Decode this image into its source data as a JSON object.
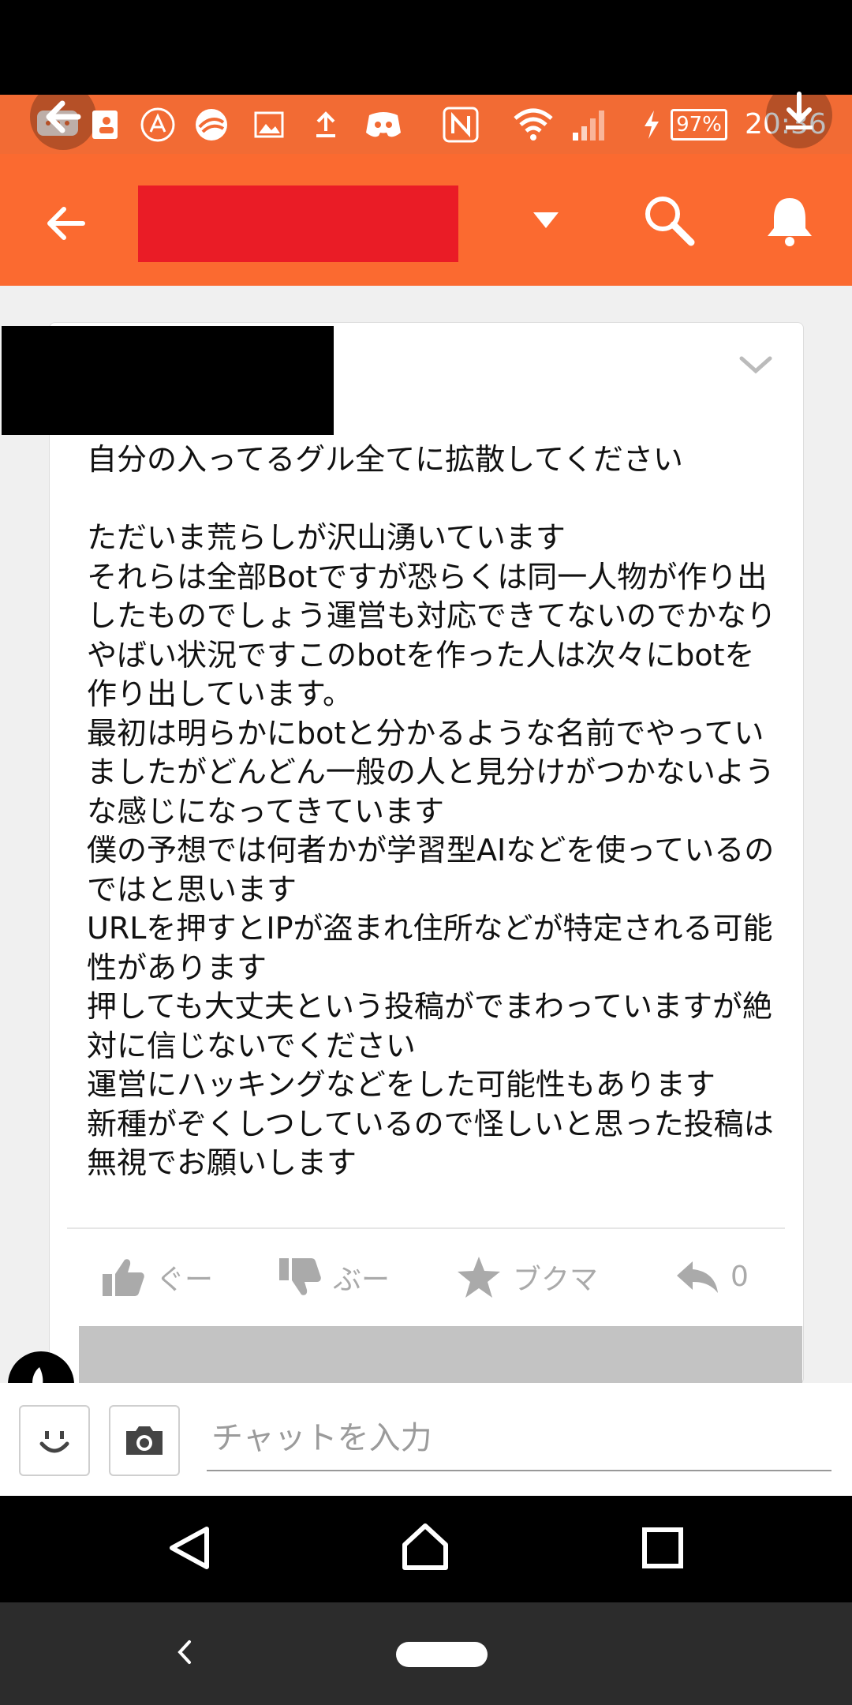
{
  "status_bar": {
    "battery": "97%",
    "time": "20:36",
    "icons": [
      "back-arrow-overlay-icon",
      "message-icon",
      "contact-card-icon",
      "vpn-icon",
      "trend-micro-icon",
      "gallery-icon",
      "upload-icon",
      "discord-icon",
      "nfc-icon",
      "wifi-icon",
      "signal-icon",
      "charging-icon",
      "battery-icon",
      "download-overlay-icon"
    ]
  },
  "app_bar": {
    "icons": [
      "back-arrow-icon",
      "dropdown-triangle-icon",
      "search-icon",
      "bell-icon"
    ]
  },
  "post": {
    "text": "自分の入ってるグル全てに拡散してください\n\nただいま荒らしが沢山湧いています\nそれらは全部Botですが恐らくは同一人物が作り出したものでしょう運営も対応できてないのでかなりやばい状況ですこのbotを作った人は次々にbotを作り出しています。\n最初は明らかにbotと分かるような名前でやっていましたがどんどん一般の人と見分けがつかないような感じになってきています\n僕の予想では何者かが学習型AIなどを使っているのではと思います\nURLを押すとIPが盗まれ住所などが特定される可能性があります\n押しても大丈夫という投稿がでまわっていますが絶対に信じないでください\n運営にハッキングなどをした可能性もあります\n新種がぞくしつしているので怪しいと思った投稿は無視でお願いします",
    "actions": {
      "good_label": "ぐー",
      "boo_label": "ぶー",
      "bookmark_label": "ブクマ",
      "reply_count": "0"
    }
  },
  "chat": {
    "placeholder": "チャットを入力"
  },
  "colors": {
    "status_bar": "#f26b34",
    "app_bar": "#fb6a30",
    "redaction_red": "#ea1c26"
  }
}
